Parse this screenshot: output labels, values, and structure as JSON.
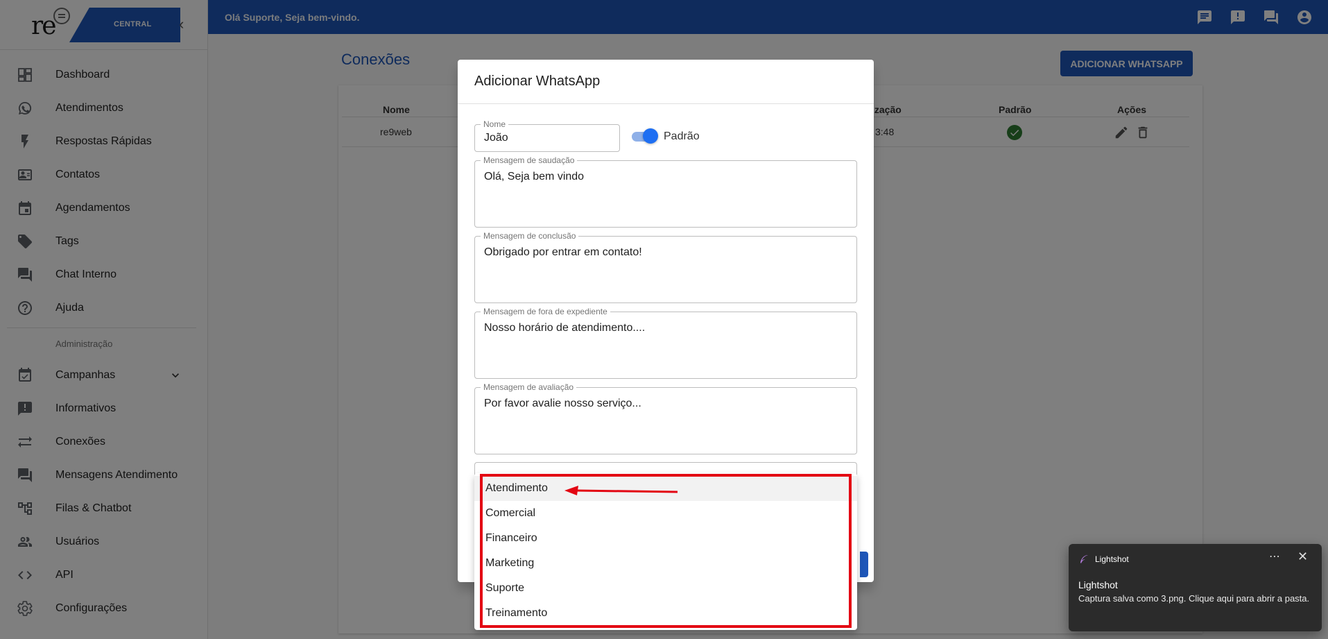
{
  "brand": {
    "logo_text": "re",
    "logo_sub": "CENTRAL"
  },
  "sidebar": {
    "items": [
      {
        "label": "Dashboard",
        "icon": "dashboard-icon"
      },
      {
        "label": "Atendimentos",
        "icon": "whatsapp-icon"
      },
      {
        "label": "Respostas Rápidas",
        "icon": "flash-icon"
      },
      {
        "label": "Contatos",
        "icon": "contact-card-icon"
      },
      {
        "label": "Agendamentos",
        "icon": "calendar-icon"
      },
      {
        "label": "Tags",
        "icon": "tag-icon"
      },
      {
        "label": "Chat Interno",
        "icon": "chat-forum-icon"
      },
      {
        "label": "Ajuda",
        "icon": "help-icon"
      }
    ],
    "section_label": "Administração",
    "admin_items": [
      {
        "label": "Campanhas",
        "icon": "event-available-icon"
      },
      {
        "label": "Informativos",
        "icon": "announcement-icon"
      },
      {
        "label": "Conexões",
        "icon": "sync-alt-icon"
      },
      {
        "label": "Mensagens Atendimento",
        "icon": "chat-forum-icon"
      },
      {
        "label": "Filas & Chatbot",
        "icon": "account-tree-icon"
      },
      {
        "label": "Usuários",
        "icon": "people-icon"
      },
      {
        "label": "API",
        "icon": "code-icon"
      },
      {
        "label": "Configurações",
        "icon": "settings-icon"
      }
    ]
  },
  "topbar": {
    "greeting": "Olá Suporte, Seja bem-vindo.",
    "color": "#1e56b8"
  },
  "main": {
    "title": "Conexões",
    "add_button": "ADICIONAR WHATSAPP",
    "table": {
      "headers": {
        "name": "Nome",
        "updated": "ização",
        "default": "Padrão",
        "actions": "Ações"
      },
      "row": {
        "name": "re9web",
        "updated": "3:48"
      }
    }
  },
  "dialog": {
    "title": "Adicionar WhatsApp",
    "name": {
      "label": "Nome",
      "value": "João"
    },
    "default_switch": {
      "label": "Padrão",
      "checked": true
    },
    "greeting": {
      "label": "Mensagem de saudação",
      "value": "Olá, Seja bem vindo"
    },
    "completion": {
      "label": "Mensagem de conclusão",
      "value": "Obrigado por entrar em contato!"
    },
    "out_of_hours": {
      "label": "Mensagem de fora de expediente",
      "value": "Nosso horário de atendimento...."
    },
    "rating": {
      "label": "Mensagem de avaliação",
      "value": "Por favor avalie nosso serviço..."
    }
  },
  "dropdown": {
    "options": [
      "Atendimento",
      "Comercial",
      "Financeiro",
      "Marketing",
      "Suporte",
      "Treinamento"
    ],
    "highlighted": "Atendimento"
  },
  "toast": {
    "app": "Lightshot",
    "title": "Lightshot",
    "body": "Captura salva como 3.png. Clique aqui para abrir a pasta."
  }
}
